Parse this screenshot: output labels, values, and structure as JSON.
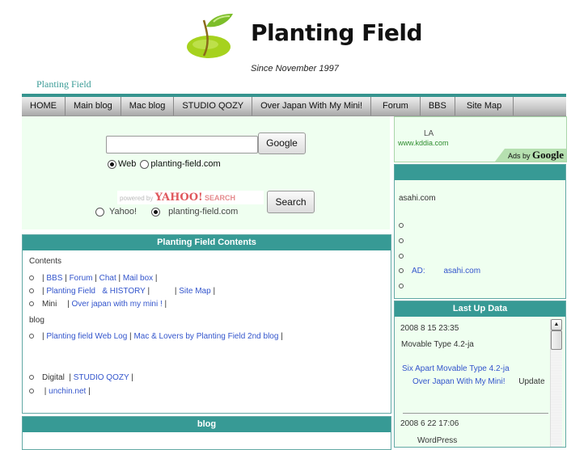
{
  "header": {
    "title": "Planting Field",
    "tagline": "Since November 1997",
    "small_title": "Planting Field"
  },
  "nav": {
    "items": [
      "HOME",
      "Main blog",
      "Mac blog",
      "STUDIO QOZY",
      "Over Japan With My Mini!",
      "Forum",
      "BBS",
      "Site Map"
    ]
  },
  "search": {
    "google_input_value": "",
    "google_button": "Google",
    "google_radio_web": "Web",
    "google_radio_site": "planting-field.com",
    "yahoo_powered": "powered by",
    "yahoo_logo": "YAHOO!",
    "yahoo_search_word": "SEARCH",
    "yahoo_button": "Search",
    "yahoo_radio_yahoo": "Yahoo!",
    "yahoo_radio_site": "planting-field.com"
  },
  "ad": {
    "title": "LA",
    "url": "www.kddia.com",
    "ads_by": "Ads by",
    "google": "Google"
  },
  "news": {
    "source": "asahi.com",
    "ad_label": "AD:",
    "ad_link": "asahi.com"
  },
  "contents": {
    "title": "Planting Field Contents",
    "heading1": "Contents",
    "row1": [
      "BBS",
      "Forum",
      "Chat",
      "Mail box"
    ],
    "row2": [
      "Planting Field   & HISTORY",
      "Site Map"
    ],
    "row3_label": "Mini",
    "row3_link": "Over japan with my mini !",
    "heading2": "blog",
    "row4": [
      "Planting field Web Log",
      "Mac & Lovers by Planting Field 2nd blog"
    ],
    "row5_label": "Digital",
    "row5_link": "STUDIO QOZY",
    "row6_link": "unchin.net"
  },
  "blog": {
    "title": "blog"
  },
  "updates": {
    "title": "Last Up Data",
    "entries": [
      {
        "date": "2008 8 15  23:35",
        "subject": "Movable Type 4.2-ja",
        "link1": "Six Apart  Movable Type 4.2-ja",
        "link2": "Over Japan With My Mini!",
        "tail": "Update"
      },
      {
        "date": "2008 6 22  17:06",
        "subject": "WordPress"
      }
    ]
  }
}
